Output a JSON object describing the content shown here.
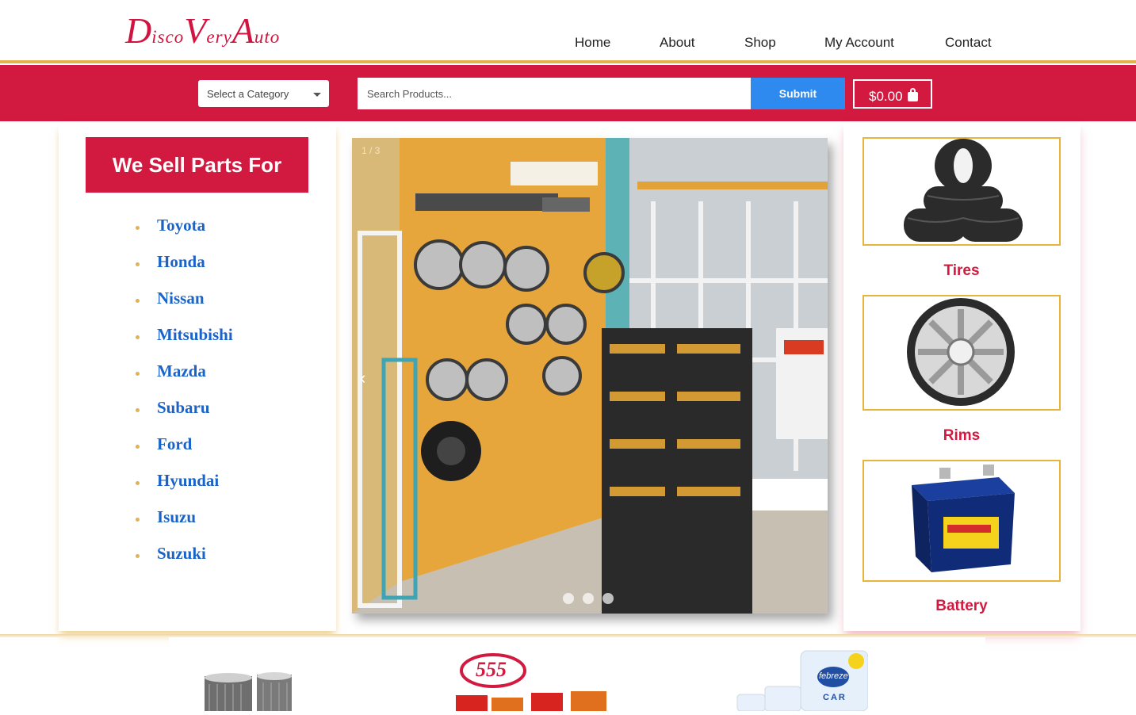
{
  "logo": {
    "text_big_1": "D",
    "text_small_1": "isco",
    "text_big_2": "V",
    "text_small_2": "ery",
    "text_big_3": "A",
    "text_small_3": "uto"
  },
  "nav": {
    "items": [
      "Home",
      "About",
      "Shop",
      "My Account",
      "Contact"
    ]
  },
  "search": {
    "category_selected": "Select a Category",
    "placeholder": "Search Products...",
    "submit_label": "Submit",
    "cart_total": "$0.00"
  },
  "left_panel": {
    "title": "We Sell Parts For",
    "brands": [
      "Toyota",
      "Honda",
      "Nissan",
      "Mitsubishi",
      "Mazda",
      "Subaru",
      "Ford",
      "Hyundai",
      "Isuzu",
      "Suzuki"
    ]
  },
  "slider": {
    "counter": "1 / 3",
    "prev_symbol": "‹"
  },
  "categories": [
    {
      "label": "Tires"
    },
    {
      "label": "Rims"
    },
    {
      "label": "Battery"
    }
  ],
  "bottom_products": {
    "spark_brand": "555",
    "freshener_brand": "febreze",
    "freshener_line": "CAR"
  },
  "colors": {
    "brand_red": "#d2193f",
    "gold": "#e2b34a",
    "submit_blue": "#2f8af0",
    "link_blue": "#1a63c9"
  }
}
